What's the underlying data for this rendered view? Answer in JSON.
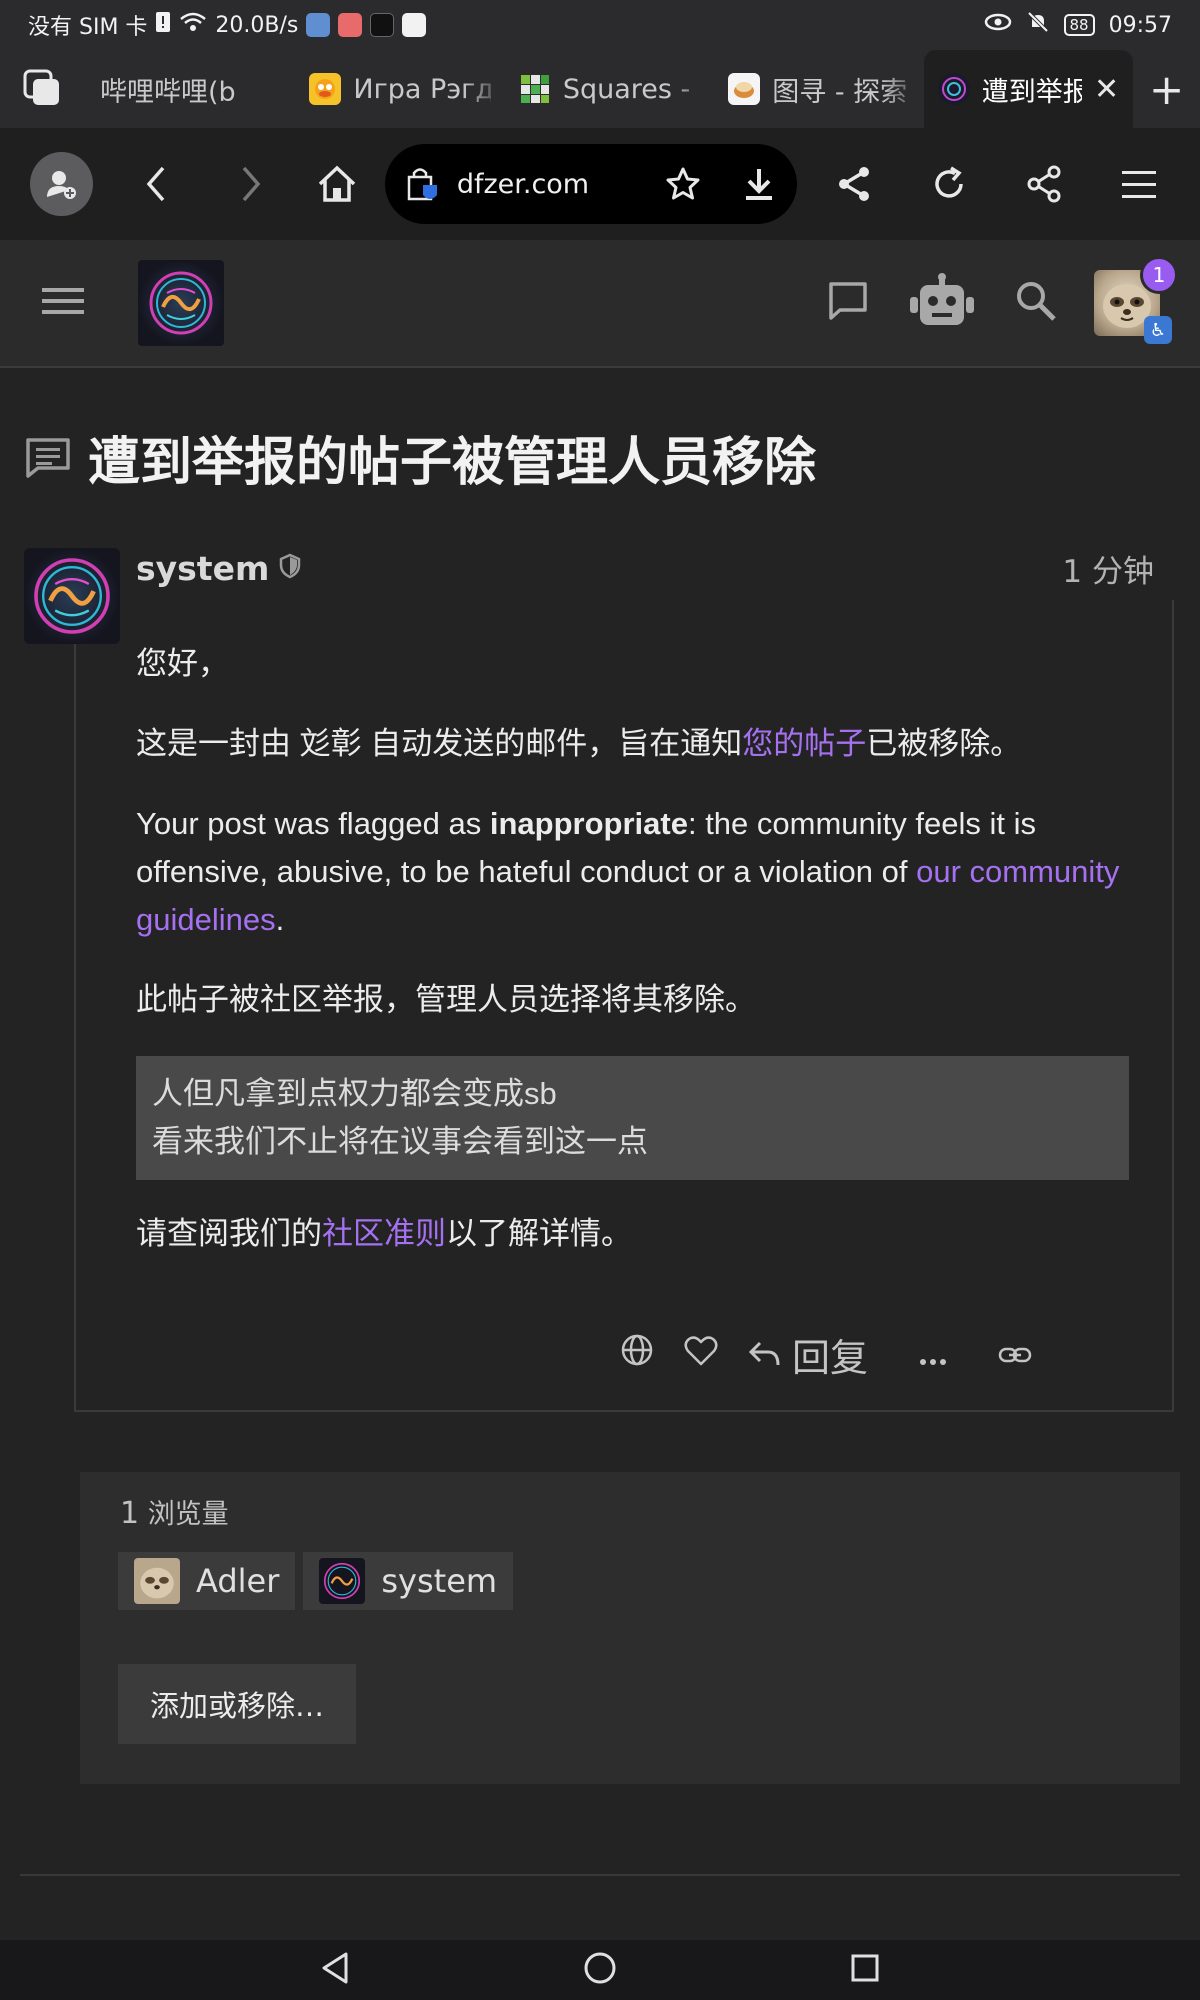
{
  "status_bar": {
    "carrier": "没有 SIM 卡",
    "net_type": "5",
    "speed": "20.0B/s",
    "battery": "88",
    "time": "09:57"
  },
  "tabs": [
    {
      "title": "哔哩哔哩(b",
      "active": false
    },
    {
      "title": "Игра Рэгд",
      "active": false
    },
    {
      "title": "Squares - [",
      "active": false
    },
    {
      "title": "图寻 - 探索",
      "active": false
    },
    {
      "title": "遭到举报",
      "active": true
    }
  ],
  "url": "dfzer.com",
  "header": {
    "notifications_count": "1"
  },
  "topic": {
    "title": "遭到举报的帖子被管理人员移除"
  },
  "post": {
    "username": "system",
    "time": "1 分钟",
    "greeting": "您好，",
    "line1_prefix": "这是一封由 彣彰 自动发送的邮件，旨在通知",
    "line1_link": "您的帖子",
    "line1_suffix": "已被移除。",
    "flag_prefix": "Your post was flagged as ",
    "flag_bold": "inappropriate",
    "flag_mid": ": the community feels it is offensive, abusive, to be hateful conduct or a violation of ",
    "flag_link": "our community guidelines",
    "flag_end": ".",
    "removed_note": "此帖子被社区举报，管理人员选择将其移除。",
    "quote_line1": "人但凡拿到点权力都会变成sb",
    "quote_line2": "看来我们不止将在议事会看到这一点",
    "guide_prefix": "请查阅我们的",
    "guide_link": "社区准则",
    "guide_suffix": "以了解详情。",
    "reply_label": "回复"
  },
  "topic_map": {
    "views_count": "1",
    "views_label": "浏览量",
    "participants": [
      "Adler",
      "system"
    ],
    "add_remove_label": "添加或移除…"
  },
  "colors": {
    "link": "#a571f0",
    "badge": "#9a5cf0",
    "background": "#232324"
  }
}
